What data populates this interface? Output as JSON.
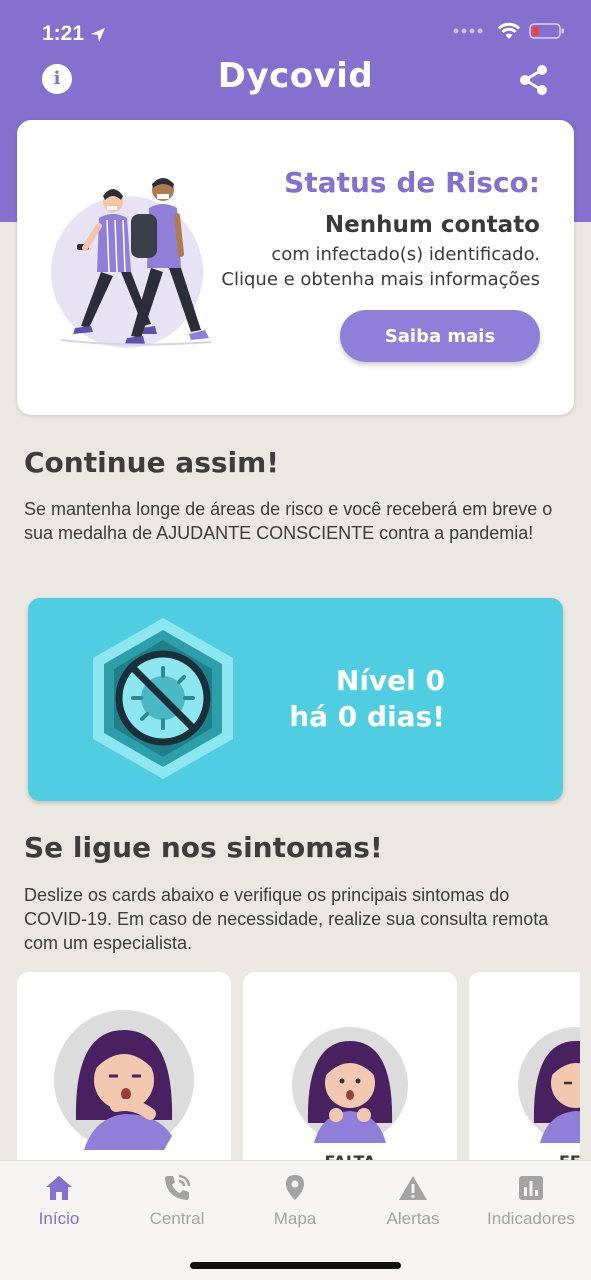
{
  "status_bar": {
    "time": "1:21"
  },
  "header": {
    "title": "Dycovid",
    "info_icon": "info-icon",
    "share_icon": "share-icon"
  },
  "risk_card": {
    "title": "Status de Risco:",
    "headline": "Nenhum contato",
    "line1": "com infectado(s) identificado.",
    "line2": "Clique e obtenha mais informações",
    "button_label": "Saiba mais"
  },
  "continue_section": {
    "title": "Continue assim!",
    "text": "Se mantenha longe de áreas de risco e você receberá em breve o sua medalha de AJUDANTE CONSCIENTE contra a pandemia!"
  },
  "level_card": {
    "line1": "Nível 0",
    "line2": "há 0 dias!"
  },
  "symptoms_section": {
    "title": "Se ligue nos sintomas!",
    "text": "Deslize os cards abaixo e verifique os principais sintomas do COVID-19. Em caso de necessidade, realize sua consulta remota com um especialista.",
    "cards": [
      {
        "label": ""
      },
      {
        "label": "FALTA"
      },
      {
        "label": "FEB"
      }
    ]
  },
  "tab_bar": {
    "tabs": [
      {
        "label": "Início",
        "icon": "home-icon",
        "active": true
      },
      {
        "label": "Central",
        "icon": "phone-icon",
        "active": false
      },
      {
        "label": "Mapa",
        "icon": "map-pin-icon",
        "active": false
      },
      {
        "label": "Alertas",
        "icon": "alert-icon",
        "active": false
      },
      {
        "label": "Indicadores",
        "icon": "bar-chart-icon",
        "active": false
      }
    ]
  },
  "colors": {
    "primary": "#8370cf",
    "teal": "#50cde0",
    "background": "#ebe8e3"
  }
}
